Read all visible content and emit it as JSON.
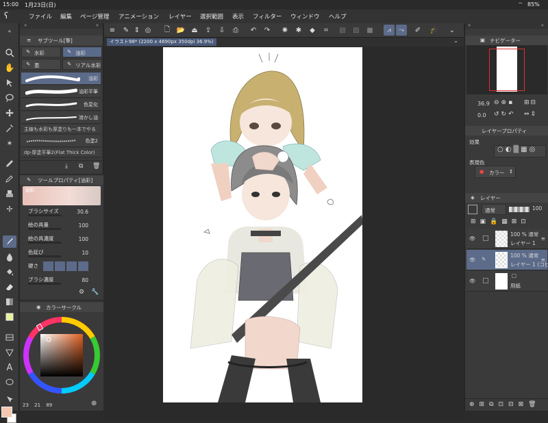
{
  "status": {
    "time": "15:00",
    "date": "1月23日(日)",
    "battery": "85%"
  },
  "menu": [
    "ファイル",
    "編集",
    "ページ管理",
    "アニメーション",
    "レイヤー",
    "選択範囲",
    "表示",
    "フィルター",
    "ウィンドウ",
    "ヘルプ"
  ],
  "subtool": {
    "title": "サブツール[筆]",
    "groups": [
      "水彩",
      "油彩",
      "墨",
      "リアル水彩"
    ],
    "brushes": [
      "油彩",
      "油彩平筆",
      "色変化",
      "溶かし油",
      "主線も水彩も厚塗りも一本でやる",
      "色塗2",
      "dp-厚塗平筆2(Flat Thick Color)"
    ]
  },
  "toolprop": {
    "title": "ツールプロパティ[油彩]",
    "preset": "油彩",
    "rows": [
      {
        "label": "ブラシサイズ",
        "value": "30.6"
      },
      {
        "label": "絵の具量",
        "value": "100"
      },
      {
        "label": "絵の具濃度",
        "value": "100"
      },
      {
        "label": "色延び",
        "value": "10"
      },
      {
        "label": "硬さ",
        "value": ""
      },
      {
        "label": "ブラシ濃度",
        "value": "80"
      }
    ]
  },
  "color": {
    "title": "カラーサークル",
    "main_color": "#f2c8b0",
    "readout": [
      "23",
      "21",
      "89"
    ]
  },
  "canvas": {
    "tab_title": "イラスト98* (2200 x 4690px 350dpi 36.9%)"
  },
  "navigator": {
    "title": "ナビゲーター",
    "zoom": "36.9",
    "angle": "0.0"
  },
  "layer_prop": {
    "title": "レイヤープロパティ",
    "effect_label": "効果",
    "express_label": "表現色",
    "express_value": "カラー"
  },
  "layers": {
    "title": "レイヤー",
    "blend": "通常",
    "opacity": "100",
    "items": [
      {
        "opacity": "100 % 通常",
        "name": "レイヤー 1"
      },
      {
        "opacity": "100 % 通常",
        "name": "レイヤー 1 (コピー)"
      },
      {
        "opacity": "",
        "name": "用紙"
      }
    ]
  }
}
